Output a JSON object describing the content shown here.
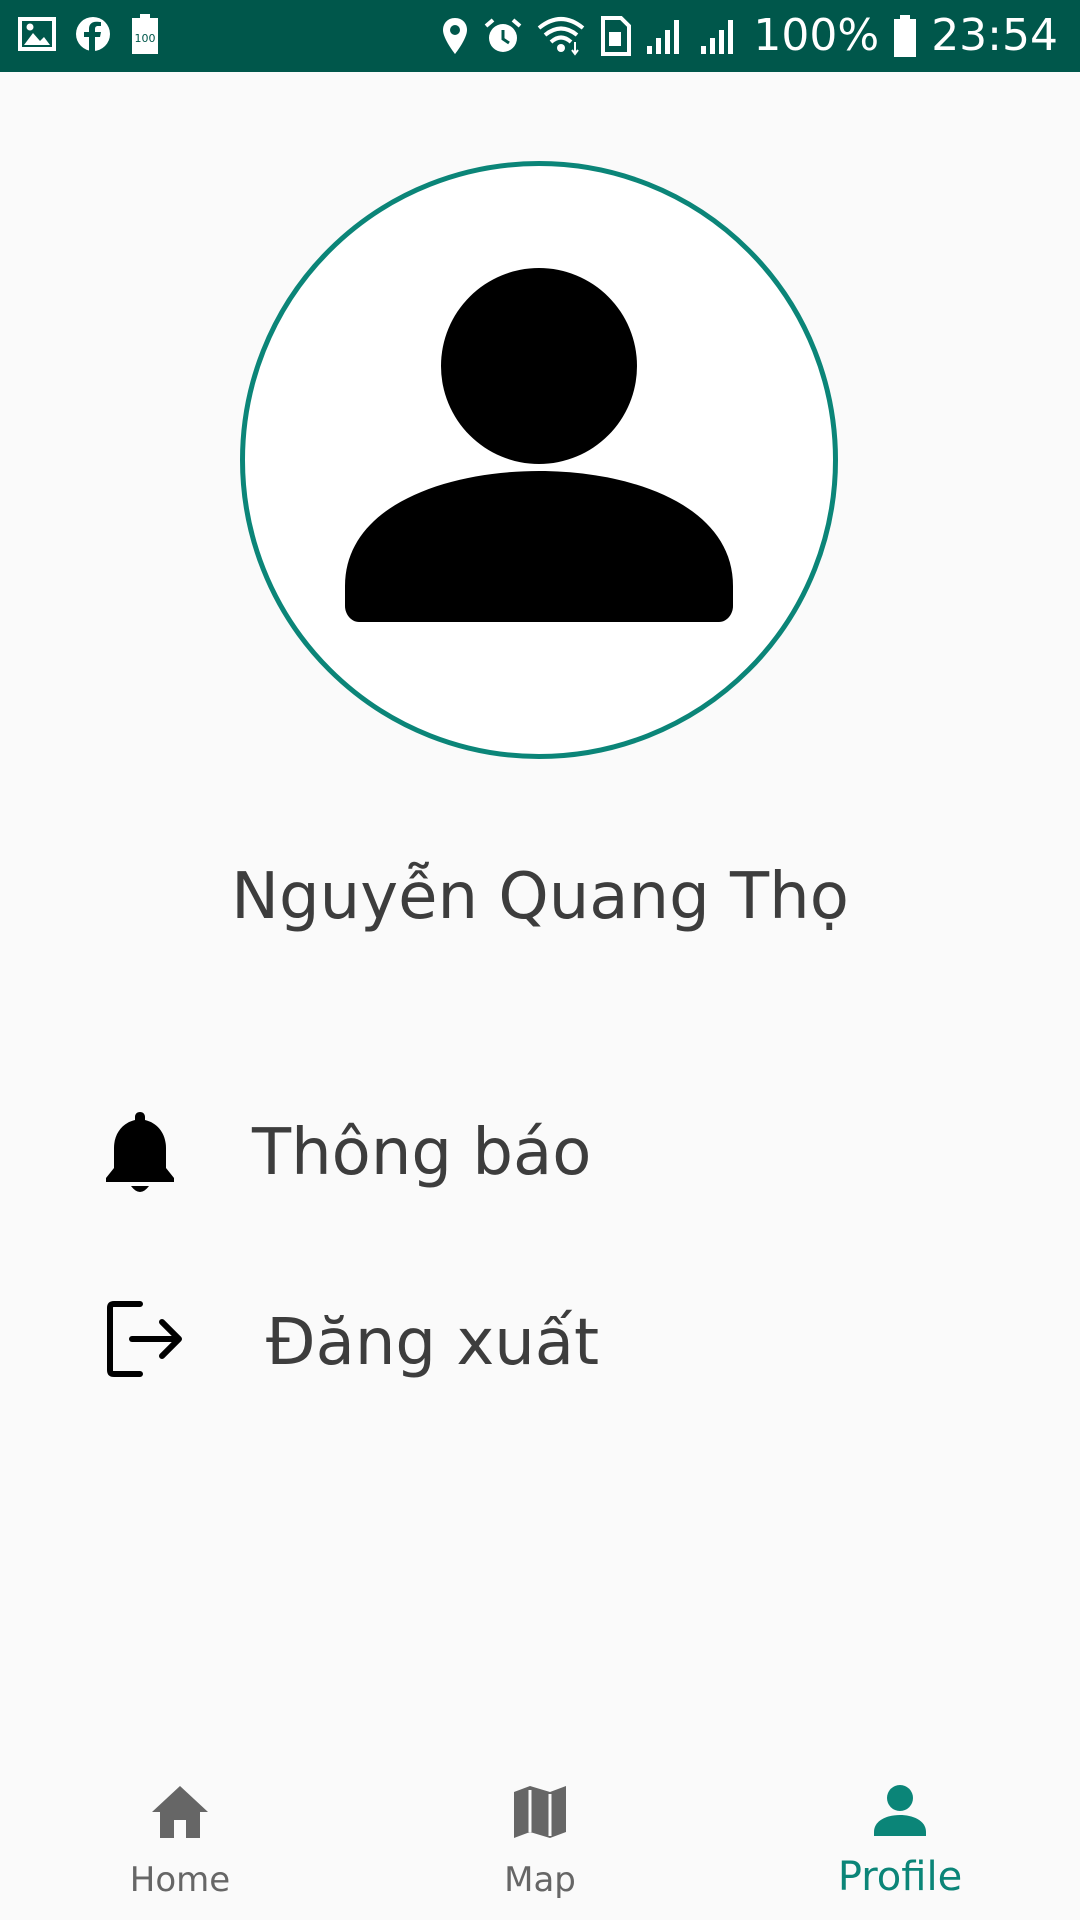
{
  "status_bar": {
    "battery_percent": "100%",
    "time": "23:54",
    "background_color": "#00574b",
    "left_icons": [
      "gallery-icon",
      "facebook-icon",
      "battery-100-icon"
    ],
    "right_icons": [
      "location-icon",
      "alarm-icon",
      "wifi-icon",
      "sim-icon",
      "signal-1-icon",
      "signal-2-icon",
      "battery-icon"
    ]
  },
  "profile": {
    "user_name": "Nguyễn Quang Thọ",
    "avatar_icon": "person-placeholder-icon",
    "avatar_border_color": "#0b8578"
  },
  "menu": {
    "notifications_label": "Thông báo",
    "notifications_icon": "bell-icon",
    "logout_label": "Đăng xuất",
    "logout_icon": "logout-icon"
  },
  "bottom_nav": {
    "items": [
      {
        "label": "Home",
        "icon": "home-icon",
        "active": false
      },
      {
        "label": "Map",
        "icon": "map-icon",
        "active": false
      },
      {
        "label": "Profile",
        "icon": "person-icon",
        "active": true
      }
    ],
    "active_color": "#0b8578",
    "inactive_color": "#666666"
  }
}
